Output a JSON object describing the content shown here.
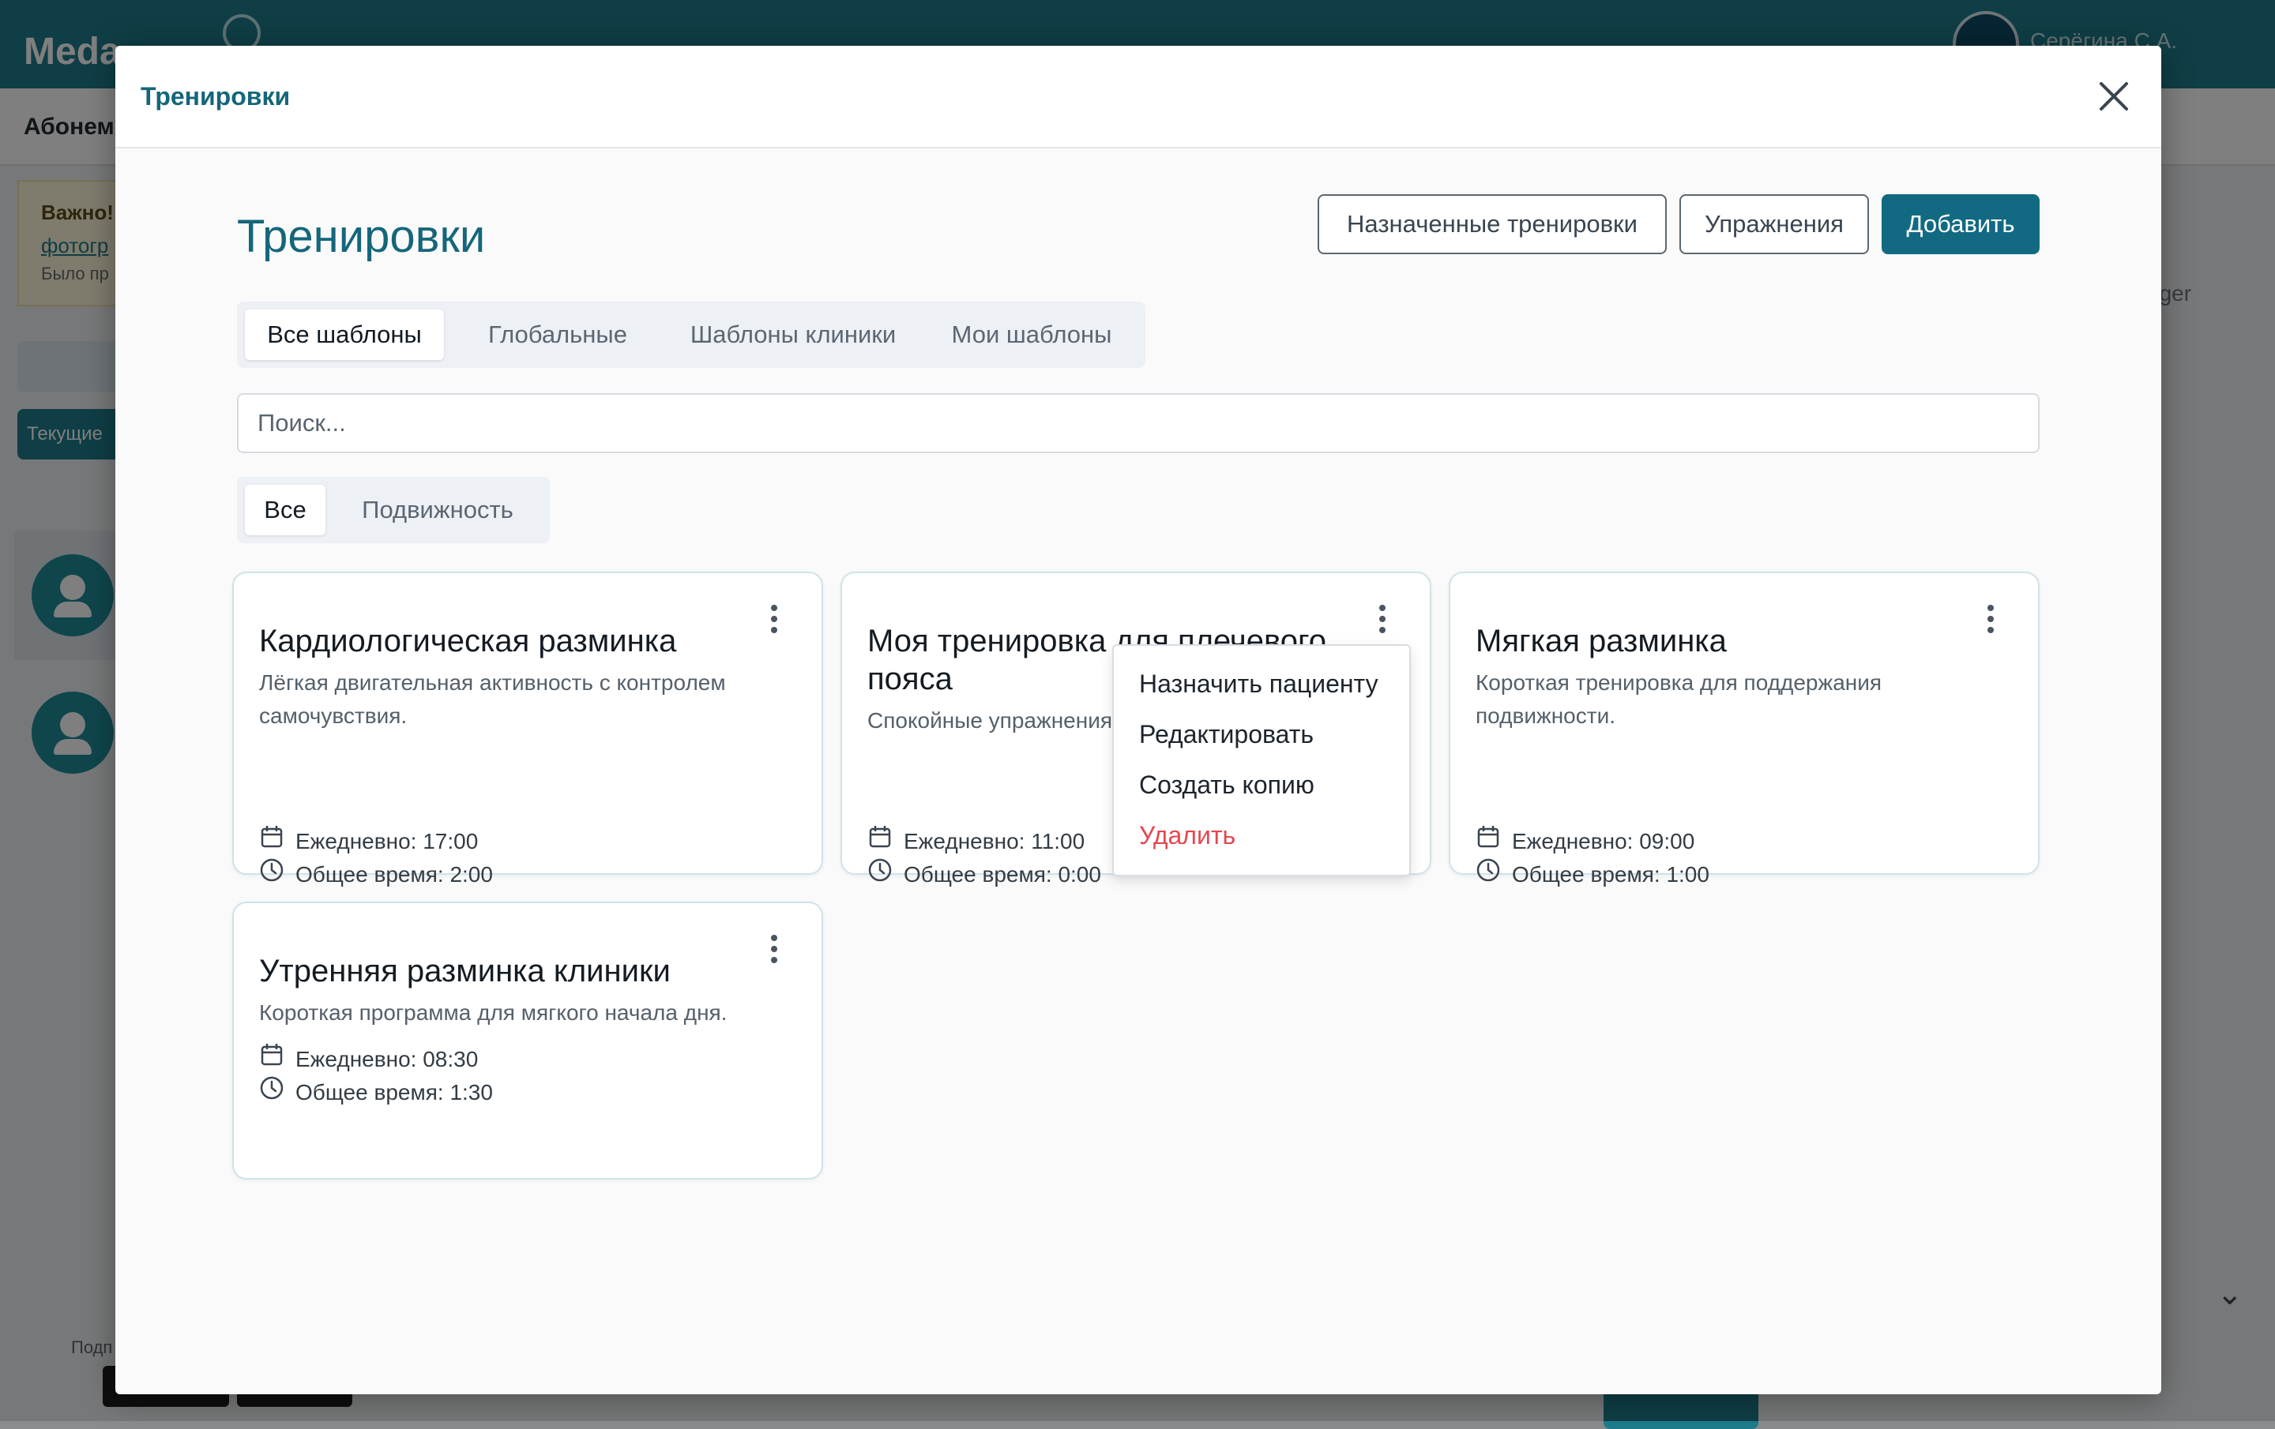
{
  "background": {
    "logo": "Meda",
    "user_name": "Серёгина С.А.",
    "subnav_label": "Абонем",
    "note_title": "Важно!",
    "note_link": "фотогр",
    "note_text": "Было пр",
    "current_btn": "Текущие",
    "right_text": "ager",
    "footer_label": "Подп"
  },
  "modal": {
    "header_title": "Тренировки",
    "close_label": "close"
  },
  "page": {
    "title": "Тренировки",
    "buttons": {
      "assigned": "Назначенные тренировки",
      "exercises": "Упражнения",
      "add": "Добавить"
    },
    "tabs": [
      {
        "label": "Все шаблоны",
        "active": true
      },
      {
        "label": "Глобальные",
        "active": false
      },
      {
        "label": "Шаблоны клиники",
        "active": false
      },
      {
        "label": "Мои шаблоны",
        "active": false
      }
    ],
    "search": {
      "placeholder": "Поиск...",
      "value": ""
    },
    "filters": [
      {
        "label": "Все",
        "active": true
      },
      {
        "label": "Подвижность",
        "active": false
      }
    ]
  },
  "cards": [
    {
      "title": "Кардиологическая разминка",
      "description": "Лёгкая двигательная активность с контролем самочувствия.",
      "schedule": "Ежедневно: 17:00",
      "total": "Общее время: 2:00"
    },
    {
      "title": "Моя тренировка для плечевого пояса",
      "description": "Спокойные упражнения для подвижности плеч.",
      "schedule": "Ежедневно: 11:00",
      "total": "Общее время: 0:00"
    },
    {
      "title": "Мягкая разминка",
      "description": "Короткая тренировка для поддержания подвижности.",
      "schedule": "Ежедневно: 09:00",
      "total": "Общее время: 1:00"
    },
    {
      "title": "Утренняя разминка клиники",
      "description": "Короткая программа для мягкого начала дня.",
      "schedule": "Ежедневно: 08:30",
      "total": "Общее время: 1:30"
    }
  ],
  "context_menu": {
    "items": [
      {
        "label": "Назначить пациенту"
      },
      {
        "label": "Редактировать"
      },
      {
        "label": "Создать копию"
      },
      {
        "label": "Удалить",
        "danger": true
      }
    ]
  },
  "colors": {
    "accent": "#15667a",
    "primary_button": "#126a82",
    "danger": "#e5474f",
    "header_bar": "#1e7c8c"
  }
}
